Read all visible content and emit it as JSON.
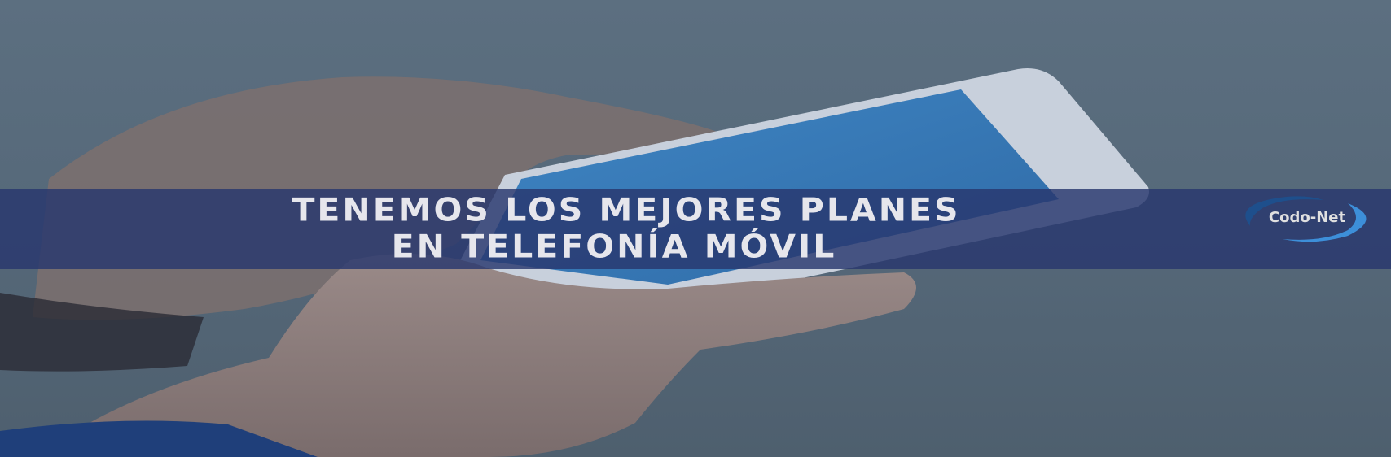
{
  "banner": {
    "headline_line1": "TENEMOS LOS MEJORES PLANES",
    "headline_line2": "EN TELEFONÍA MÓVIL",
    "logo_text": "Codo-Net"
  },
  "colors": {
    "band": "#283770",
    "text": "#e6e6ec",
    "logo_ring_dark": "#1e4f8c",
    "logo_ring_light": "#3d8fd9"
  }
}
